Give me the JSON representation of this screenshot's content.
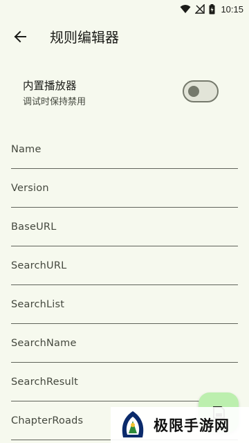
{
  "status_bar": {
    "time": "10:15"
  },
  "app_bar": {
    "title": "规则编辑器"
  },
  "toggle": {
    "title": "内置播放器",
    "subtitle": "调试时保持禁用",
    "enabled": false
  },
  "fields": [
    {
      "label": "Name"
    },
    {
      "label": "Version"
    },
    {
      "label": "BaseURL"
    },
    {
      "label": "SearchURL"
    },
    {
      "label": "SearchList"
    },
    {
      "label": "SearchName"
    },
    {
      "label": "SearchResult"
    },
    {
      "label": "ChapterRoads"
    }
  ],
  "watermark": {
    "text": "极限手游网"
  },
  "colors": {
    "background": "#f6f9ee",
    "fab": "#bcefae",
    "switch_track": "#e2e4d8",
    "outline": "#75796c"
  },
  "icons": {
    "back": "arrow-back-icon",
    "wifi": "wifi-icon",
    "signal": "no-signal-icon",
    "battery": "battery-charging-icon",
    "fab": "save-icon"
  }
}
